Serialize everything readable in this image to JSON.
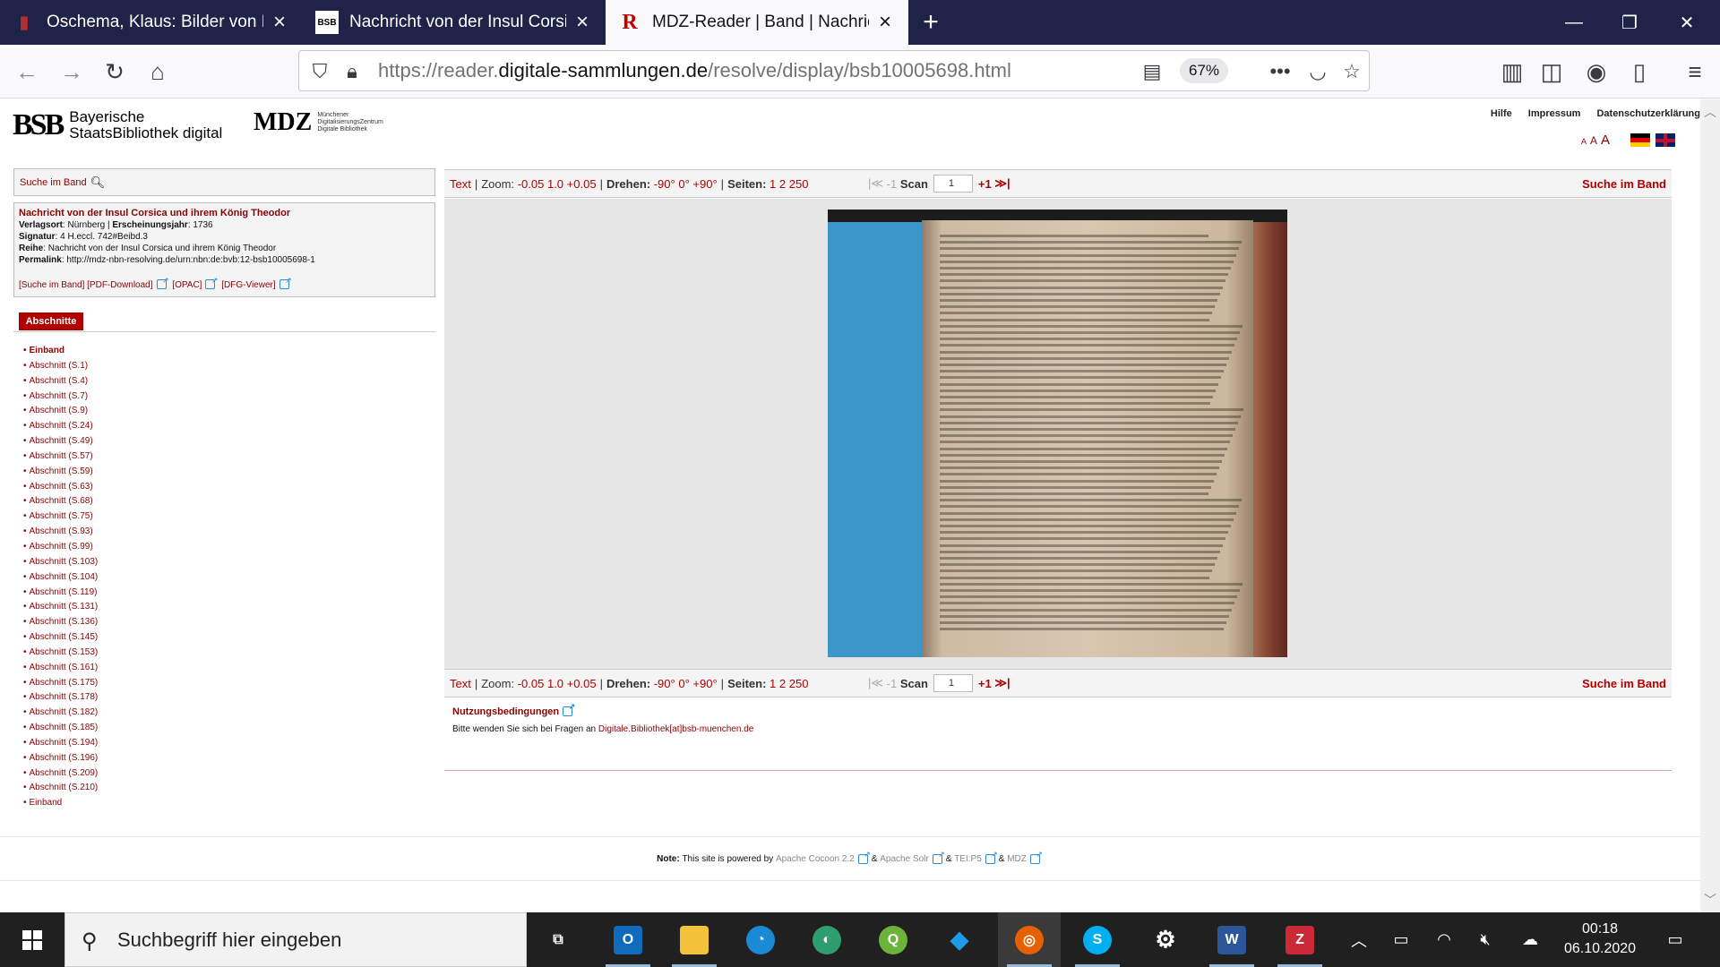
{
  "browser": {
    "tabs": [
      {
        "title": "Oschema, Klaus: Bilder von Eur",
        "icon": "book-icon",
        "active": false
      },
      {
        "title": "Nachricht von der Insul Corsica",
        "icon": "bsb-icon",
        "active": false
      },
      {
        "title": "MDZ-Reader | Band | Nachricht",
        "icon": "mdz-r-icon",
        "active": true
      }
    ],
    "url_prefix": "https://reader.",
    "url_host": "digitale-sammlungen.de",
    "url_path": "/resolve/display/bsb10005698.html",
    "zoom": "67%"
  },
  "header": {
    "bsb_mark": "BSB",
    "bsb_line1": "Bayerische",
    "bsb_line2": "StaatsBibliothek digital",
    "mdz_mark": "MDZ",
    "mdz_line1": "Münchener",
    "mdz_line2": "DigitalisierungsZentrum",
    "mdz_line3": "Digitale Bibliothek",
    "links": [
      "Hilfe",
      "Impressum",
      "Datenschutzerklärung"
    ],
    "font_sizes": [
      "A",
      "A",
      "A"
    ]
  },
  "sidebar": {
    "search_label": "Suche im Band",
    "meta": {
      "title": "Nachricht von der Insul Corsica und ihrem König Theodor",
      "verlagsort_label": "Verlagsort",
      "verlagsort": "Nürnberg",
      "jahr_label": "Erscheinungsjahr",
      "jahr": "1736",
      "signatur_label": "Signatur",
      "signatur": "4 H.eccl. 742#Beibd.3",
      "reihe_label": "Reihe",
      "reihe": "Nachricht von der Insul Corsica und ihrem König Theodor",
      "permalink_label": "Permalink",
      "permalink": "http://mdz-nbn-resolving.de/urn:nbn:de:bvb:12-bsb10005698-1",
      "link_search": "[Suche im Band]",
      "link_pdf": "[PDF-Download]",
      "link_opac": "[OPAC]",
      "link_dfg": "[DFG-Viewer]"
    },
    "sections_label": "Abschnitte",
    "toc": [
      "Einband",
      "Abschnitt  (S.1)",
      "Abschnitt  (S.4)",
      "Abschnitt  (S.7)",
      "Abschnitt  (S.9)",
      "Abschnitt  (S.24)",
      "Abschnitt  (S.49)",
      "Abschnitt  (S.57)",
      "Abschnitt  (S.59)",
      "Abschnitt  (S.63)",
      "Abschnitt  (S.68)",
      "Abschnitt  (S.75)",
      "Abschnitt  (S.93)",
      "Abschnitt  (S.99)",
      "Abschnitt  (S.103)",
      "Abschnitt  (S.104)",
      "Abschnitt  (S.119)",
      "Abschnitt  (S.131)",
      "Abschnitt  (S.136)",
      "Abschnitt  (S.145)",
      "Abschnitt  (S.153)",
      "Abschnitt  (S.161)",
      "Abschnitt  (S.175)",
      "Abschnitt  (S.178)",
      "Abschnitt  (S.182)",
      "Abschnitt  (S.185)",
      "Abschnitt  (S.194)",
      "Abschnitt  (S.196)",
      "Abschnitt  (S.209)",
      "Abschnitt  (S.210)",
      "Einband"
    ]
  },
  "viewer": {
    "text_label": "Text",
    "zoom_label": "Zoom:",
    "zoom_minus": "-0.05",
    "zoom_value": "1.0",
    "zoom_plus": "+0.05",
    "rotate_label": "Drehen:",
    "rot_minus": "-90°",
    "rot_zero": "0°",
    "rot_plus": "+90°",
    "pages_label": "Seiten:",
    "page_options": [
      "1",
      "2",
      "250"
    ],
    "minus_one": "-1",
    "scan_label": "Scan",
    "scan_value": "1",
    "plus_one": "+1",
    "search_label": "Suche im Band"
  },
  "footer": {
    "terms": "Nutzungsbedingungen",
    "contact_prefix": "Bitte wenden Sie sich bei Fragen an",
    "contact_email": "Digitale.Bibliothek[at]bsb-muenchen.de",
    "note_label": "Note:",
    "note_text": "This site is powered by",
    "cocoon": "Apache Cocoon 2.2",
    "solr": "Apache Solr",
    "tei": "TEI:P5",
    "mdz": "MDZ",
    "amp": "&"
  },
  "taskbar": {
    "search_placeholder": "Suchbegriff hier eingeben",
    "time": "00:18",
    "date": "06.10.2020"
  }
}
